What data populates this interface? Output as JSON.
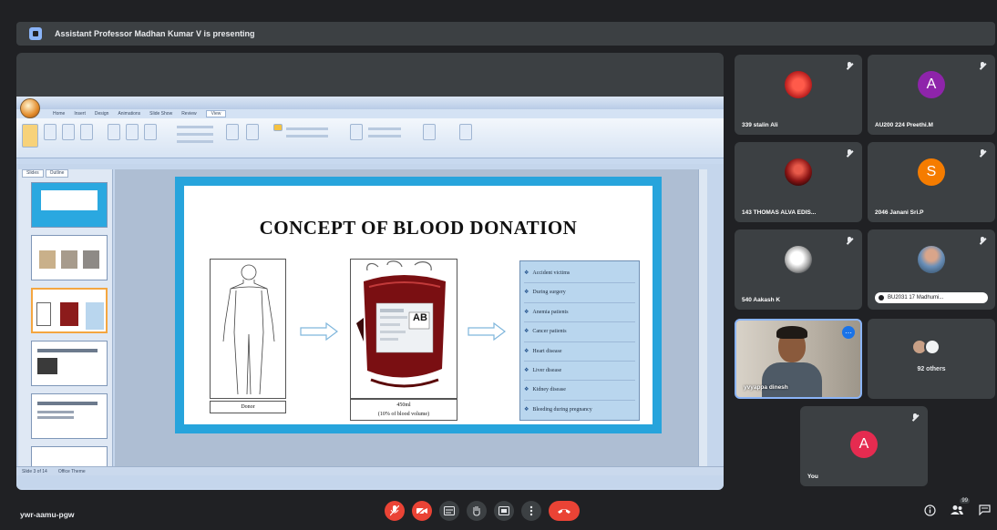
{
  "banner": {
    "text": "Assistant Professor Madhan Kumar V is presenting"
  },
  "slide": {
    "heading": "CONCEPT OF BLOOD DONATION",
    "caption_body": "Donor",
    "caption_bag_line1": "450ml",
    "caption_bag_line2": "(10% of blood volume)",
    "bag_label": "AB",
    "recipients": [
      "Accident victims",
      "During surgery",
      "Anemia patients",
      "Cancer patients",
      "Heart disease",
      "Liver disease",
      "Kidney disease",
      "Bleeding during pregnancy"
    ]
  },
  "ppt": {
    "tabs": [
      "Home",
      "Insert",
      "Design",
      "Animations",
      "Slide Show",
      "Review",
      "View"
    ],
    "active_tab": "View",
    "thumb_tabs": [
      "Slides",
      "Outline"
    ],
    "status": "Slide 3 of 14",
    "theme": "Office Theme"
  },
  "participants": [
    {
      "name": "339 stalin Ali",
      "type": "photo",
      "color": "#c62828"
    },
    {
      "name": "AU200 224 Preethi.M",
      "type": "letter",
      "letter": "A",
      "color": "#8e24aa"
    },
    {
      "name": "143 THOMAS ALVA EDIS...",
      "type": "photo",
      "color": "#b71c1c"
    },
    {
      "name": "2046 Janani Sri.P",
      "type": "letter",
      "letter": "S",
      "color": "#f57c00"
    },
    {
      "name": "540 Aakash K",
      "type": "photo",
      "color": "#e0e0e0"
    },
    {
      "name": "BU2031 17 Madhumi...",
      "type": "photo",
      "color": "#a0a0a0"
    },
    {
      "name": "yvyappa dinesh",
      "type": "video"
    },
    {
      "name": "92 others",
      "type": "others"
    },
    {
      "name": "You",
      "type": "letter",
      "letter": "A",
      "color": "#e52b50"
    }
  ],
  "meeting": {
    "code": "ywr-aamu-pgw",
    "people_count": "99"
  },
  "colors": {
    "accent_red": "#ea4335",
    "tile_bg": "#3c4043",
    "slide_border": "#27a4dc"
  },
  "icons": {
    "controls": [
      "mic-off-icon",
      "camera-off-icon",
      "captions-icon",
      "raise-hand-icon",
      "present-icon",
      "more-options-icon",
      "end-call-icon"
    ],
    "right": [
      "info-icon",
      "people-icon",
      "chat-icon"
    ]
  }
}
